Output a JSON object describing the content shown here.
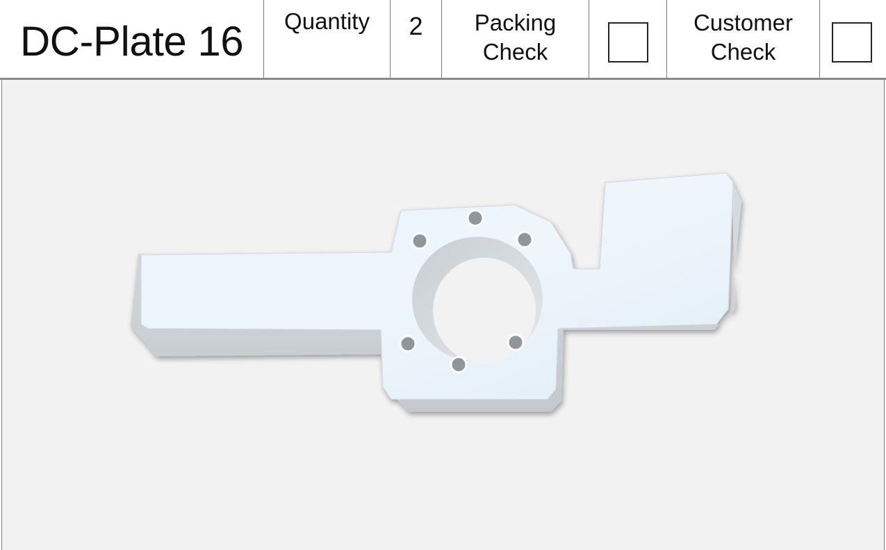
{
  "header": {
    "title": "DC-Plate 16",
    "quantity_label": "Quantity",
    "quantity_value": "2",
    "packing_check_line1": "Packing",
    "packing_check_line2": "Check",
    "customer_check_line1": "Customer",
    "customer_check_line2": "Check"
  },
  "checks": {
    "packing_checked": false,
    "customer_checked": false
  },
  "image": {
    "subject": "plate-part-render",
    "part_color": "#e6f1fa",
    "background_color": "#f2f2f2"
  }
}
